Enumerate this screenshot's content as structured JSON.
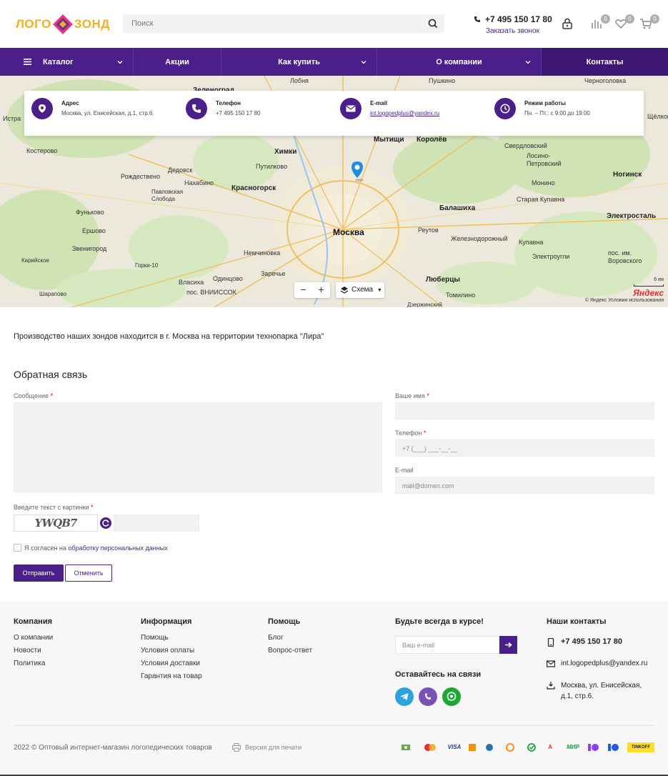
{
  "header": {
    "logo_left": "ЛОГО",
    "logo_right": "ЗОНД",
    "search_placeholder": "Поиск",
    "phone": "+7 495 150 17 80",
    "callback": "Заказать звонок",
    "compare_count": "0",
    "favorites_count": "0",
    "cart_count": "0"
  },
  "nav": {
    "items": [
      {
        "label": "Каталог"
      },
      {
        "label": "Акции"
      },
      {
        "label": "Как купить"
      },
      {
        "label": "О компании"
      },
      {
        "label": "Контакты"
      }
    ]
  },
  "info": {
    "address_title": "Адрес",
    "address_value": "Москва, ул. Енисейская, д.1, стр.6.",
    "phone_title": "Телефон",
    "phone_value": "+7 495 150 17 80",
    "email_title": "E-mail",
    "email_value": "int.logopedplus@yandex.ru",
    "hours_title": "Режим работы",
    "hours_value": "Пн. – Пт.: с 9:00 до 19:00"
  },
  "map": {
    "labels": [
      "Зеленоград",
      "Лобня",
      "Пушкино",
      "Черноголовка",
      "Истра",
      "Мытищи",
      "Королёв",
      "Щёлково",
      "Химки",
      "Путилково",
      "Свердловский",
      "Лосино-Петровский",
      "Костерово",
      "Дедовск",
      "Нахабино",
      "Красногорск",
      "Монино",
      "Ногинск",
      "Рождествено",
      "Павловская Слобода",
      "Старая Купавна",
      "Балашиха",
      "Фуньково",
      "Электросталь",
      "Ершово",
      "Москва",
      "Реутов",
      "Железнодорожный",
      "Звенигород",
      "Немчиновка",
      "Купавна",
      "Карийское",
      "Горки-10",
      "Электроугли",
      "пос. им. Воровского",
      "Власиха",
      "Одинцово",
      "Заречье",
      "Люберцы",
      "Шарапово",
      "пос. ВНИИССОК",
      "Томилино",
      "Дзержинский"
    ],
    "zoom_out": "−",
    "zoom_in": "+",
    "scheme": "Схема",
    "scale": "6 км",
    "brand": "Яндекс",
    "copyright": "© Яндекс  Условия использования"
  },
  "content": {
    "intro": "Производство наших зондов находится в г. Москва на территории технопарка \"Лира\""
  },
  "form": {
    "title": "Обратная связь",
    "message_label": "Сообщение",
    "name_label": "Ваше имя",
    "phone_label": "Телефон",
    "phone_placeholder": "+7 (___) ___-__-__",
    "email_label": "E-mail",
    "email_placeholder": "mail@domen.com",
    "captcha_label": "Введите текст с картинки",
    "captcha_text": "YWQB7",
    "agree_text": "Я согласен на ",
    "agree_link": "обработку персональных данных",
    "submit": "Отправить",
    "cancel": "Отменить",
    "required_mark": "*"
  },
  "footer": {
    "company_title": "Компания",
    "company_links": [
      "О компании",
      "Новости",
      "Политика"
    ],
    "info_title": "Информация",
    "info_links": [
      "Помощь",
      "Условия оплаты",
      "Условия доставки",
      "Гарантия на товар"
    ],
    "help_title": "Помощь",
    "help_links": [
      "Блог",
      "Вопрос-ответ"
    ],
    "subscribe_title": "Будьте всегда в курсе!",
    "subscribe_placeholder": "Ваш e-mail",
    "social_title": "Оставайтесь на связи",
    "contacts_title": "Наши контакты",
    "contact_phone": "+7 495 150 17 80",
    "contact_email": "int.logopedplus@yandex.ru",
    "contact_address_1": "Москва, ул. Енисейская,",
    "contact_address_2": "д.1, стр.6.",
    "copyright": "2022 © Оптовый интернет-магазин логопедических товаров",
    "print": "Версия для печати",
    "payments": [
      "",
      "",
      "VISA",
      "",
      "",
      "",
      "",
      "A",
      "МИР",
      "",
      "",
      "TINKOFF"
    ]
  },
  "colors": {
    "brand": "#4a1f8a",
    "accent": "#f2b01e"
  }
}
